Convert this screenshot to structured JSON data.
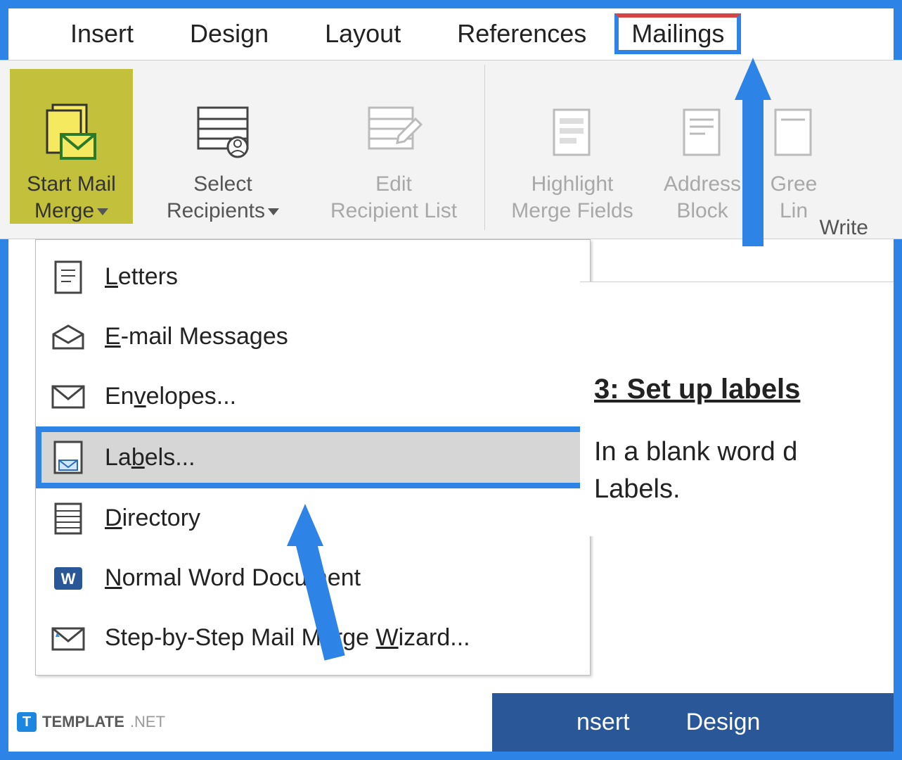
{
  "tabs": {
    "insert": "Insert",
    "design": "Design",
    "layout": "Layout",
    "references": "References",
    "mailings": "Mailings"
  },
  "ribbon": {
    "start": "Start Mail\nMerge",
    "select": "Select\nRecipients",
    "edit": "Edit\nRecipient List",
    "highlight": "Highlight\nMerge Fields",
    "address": "Address\nBlock",
    "greeting": "Gree\nLin",
    "groupWrite": "Write"
  },
  "menu": {
    "letters": "Letters",
    "email": "E-mail Messages",
    "envelopes": "Envelopes...",
    "labels": "Labels...",
    "directory": "Directory",
    "normal": "Normal Word Document",
    "wizard": "Step-by-Step Mail Merge Wizard..."
  },
  "doc": {
    "heading": "3: Set up labels",
    "body1": "In a blank word d",
    "body2": "Labels."
  },
  "lower": {
    "insert": "nsert",
    "design": "Design"
  },
  "watermark": {
    "brand": "TEMPLATE",
    "suffix": ".NET",
    "badge": "T"
  }
}
